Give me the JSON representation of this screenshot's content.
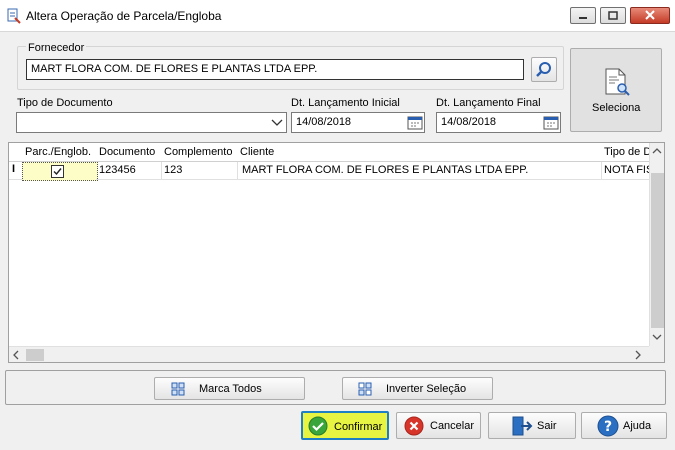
{
  "window": {
    "title": "Altera Operação de Parcela/Engloba"
  },
  "filters": {
    "fornecedor_label": "Fornecedor",
    "fornecedor_value": "MART FLORA COM. DE FLORES E PLANTAS LTDA EPP.",
    "tipo_documento_label": "Tipo de Documento",
    "tipo_documento_value": "",
    "dt_inicial_label": "Dt. Lançamento Inicial",
    "dt_inicial_value": "14/08/2018",
    "dt_final_label": "Dt. Lançamento Final",
    "dt_final_value": "14/08/2018",
    "seleciona_label": "Seleciona"
  },
  "grid": {
    "columns": [
      "Parc./Englob.",
      "Documento",
      "Complemento",
      "Cliente",
      "Tipo de D"
    ],
    "rows": [
      {
        "checked": true,
        "documento": "123456",
        "complemento": "123",
        "cliente": "MART FLORA COM. DE FLORES E PLANTAS LTDA EPP.",
        "tipo": "NOTA FIS"
      }
    ],
    "row_indicator": "I"
  },
  "actions": {
    "marca_todos": "Marca Todos",
    "inverter_selecao": "Inverter Seleção"
  },
  "footer": {
    "confirmar": "Confirmar",
    "cancelar": "Cancelar",
    "sair": "Sair",
    "ajuda": "Ajuda"
  },
  "colors": {
    "confirm_highlight": "#e7f542",
    "confirm_icon": "#3aa53a",
    "cancel_icon": "#d8352a",
    "help_icon": "#2a6fc1",
    "titlebar_close": "#c43b26"
  }
}
